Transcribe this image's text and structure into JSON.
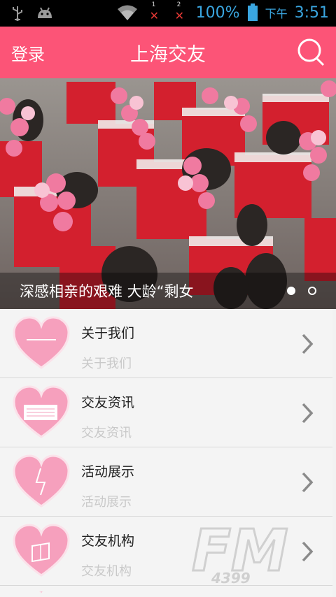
{
  "status_bar": {
    "battery_percent": "100%",
    "period": "下午",
    "time": "3:51",
    "sim1_label": "1",
    "sim2_label": "2",
    "icons": [
      "usb-icon",
      "android-icon",
      "wifi-icon",
      "signal-icon",
      "battery-icon"
    ]
  },
  "header": {
    "login_label": "登录",
    "title": "上海交友",
    "search_icon": "search-icon",
    "color": "#fc5477"
  },
  "banner": {
    "caption": "深感相亲的艰难 大龄“剩女",
    "pages": 2,
    "active_page": 1
  },
  "menu": {
    "items": [
      {
        "title": "关于我们",
        "subtitle": "关于我们",
        "icon": "heart-about-icon"
      },
      {
        "title": "交友资讯",
        "subtitle": "交友资讯",
        "icon": "heart-news-icon"
      },
      {
        "title": "活动展示",
        "subtitle": "活动展示",
        "icon": "heart-activity-icon"
      },
      {
        "title": "交友机构",
        "subtitle": "交友机构",
        "icon": "heart-org-icon"
      }
    ]
  },
  "watermark": {
    "letters": "FM",
    "number": "4399"
  }
}
